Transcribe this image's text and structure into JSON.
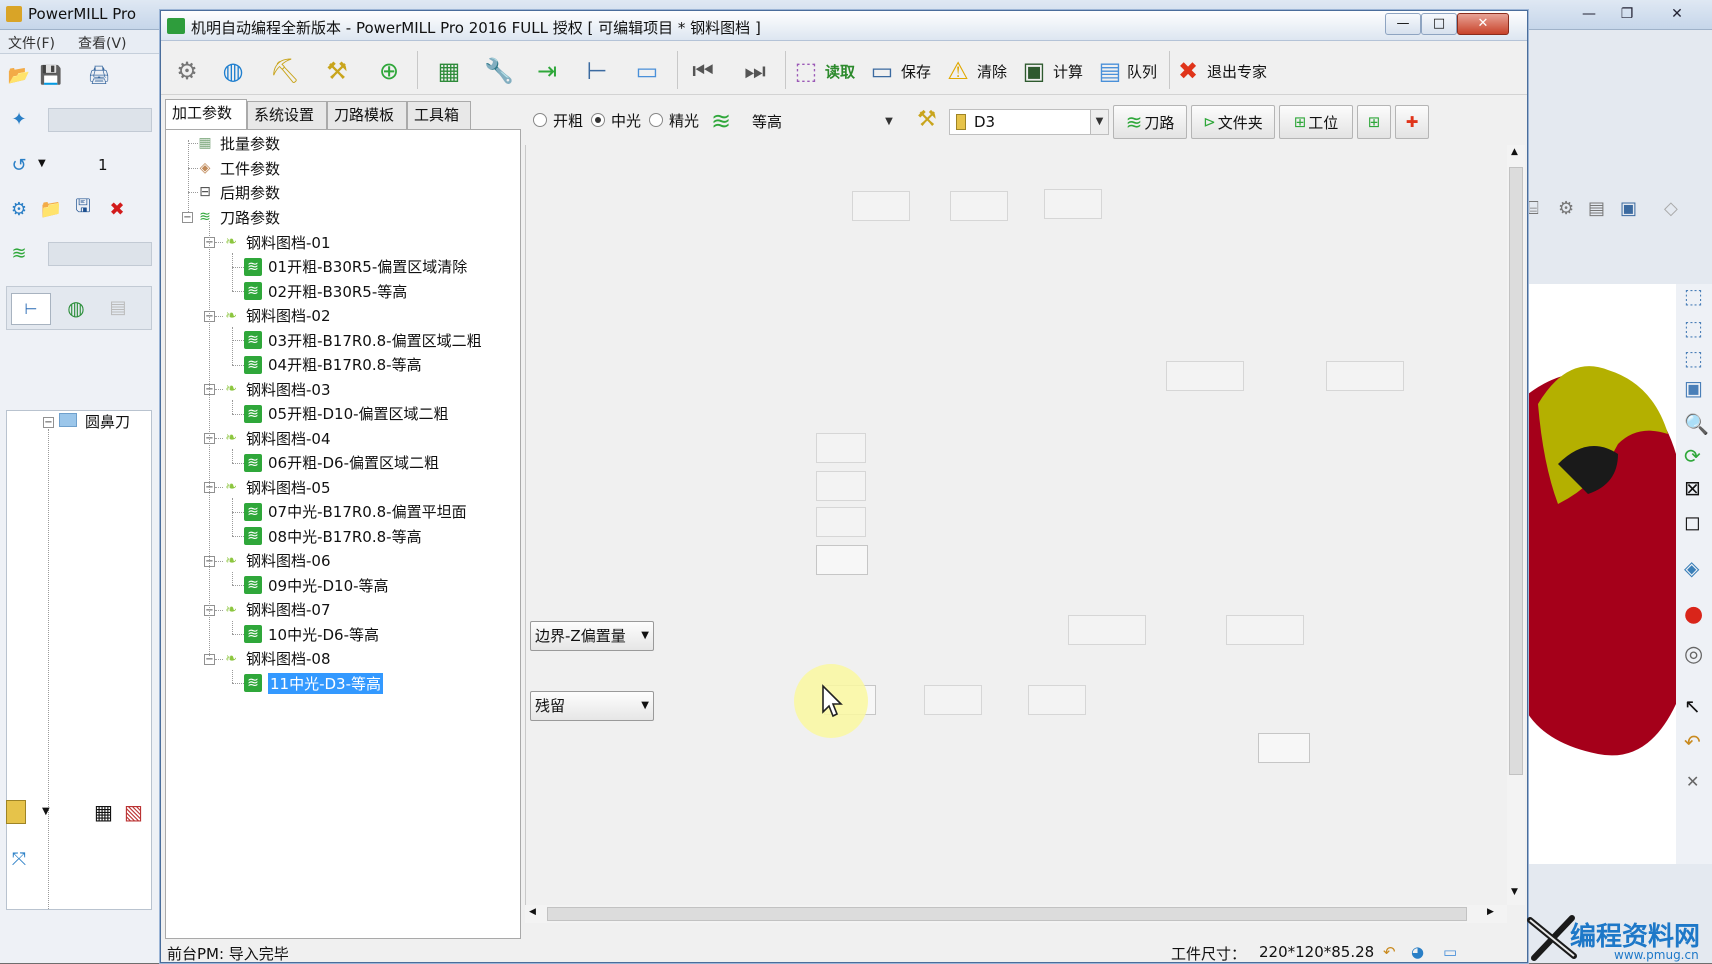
{
  "background_app": {
    "title": "PowerMILL Pro",
    "menu": [
      "文件(F)",
      "查看(V)"
    ],
    "toolbar_value": "1",
    "tree_root": "圆鼻刀"
  },
  "dialog": {
    "title": "机明自动编程全新版本 - PowerMILL Pro 2016 FULL 授权    [ 可编辑项目 * 钢料图档 ]",
    "toolbar": {
      "read_label": "读取",
      "save_label": "保存",
      "clear_label": "清除",
      "calc_label": "计算",
      "queue_label": "队列",
      "exit_label": "退出专家"
    },
    "tabs": [
      "加工参数",
      "系统设置",
      "刀路模板",
      "工具箱"
    ],
    "tree": {
      "top_items": [
        "批量参数",
        "工件参数",
        "后期参数",
        "刀路参数"
      ],
      "groups": [
        {
          "label": "钢料图档-01",
          "items": [
            "01开粗-B30R5-偏置区域清除",
            "02开粗-B30R5-等高"
          ]
        },
        {
          "label": "钢料图档-02",
          "items": [
            "03开粗-B17R0.8-偏置区域二粗",
            "04开粗-B17R0.8-等高"
          ]
        },
        {
          "label": "钢料图档-03",
          "items": [
            "05开粗-D10-偏置区域二粗"
          ]
        },
        {
          "label": "钢料图档-04",
          "items": [
            "06开粗-D6-偏置区域二粗"
          ]
        },
        {
          "label": "钢料图档-05",
          "items": [
            "07中光-B17R0.8-偏置平坦面",
            "08中光-B17R0.8-等高"
          ]
        },
        {
          "label": "钢料图档-06",
          "items": [
            "09中光-D10-等高"
          ]
        },
        {
          "label": "钢料图档-07",
          "items": [
            "10中光-D6-等高"
          ]
        },
        {
          "label": "钢料图档-08",
          "items": [
            "11中光-D3-等高"
          ]
        }
      ],
      "selected": "11中光-D3-等高"
    },
    "options": {
      "radio_labels": [
        "开粗",
        "中光",
        "精光"
      ],
      "selected_radio": "中光",
      "strategy_value": "等高",
      "tool_value": "D3",
      "toolpath_btn": "刀路",
      "folder_btn": "文件夹",
      "workplane_btn": "工位"
    },
    "canvas": {
      "boundary_dropdown": "边界-Z偏置量",
      "residual_dropdown": "残留"
    },
    "status": {
      "left": "前台PM: 导入完毕",
      "size_label": "工件尺寸：",
      "size_value": "220*120*85.28"
    }
  },
  "watermark": {
    "text": "编程资料网",
    "url": "www.pmug.cn"
  },
  "colors": {
    "selection": "#3399ff",
    "model_red": "#a5001a",
    "model_yellow": "#b4b000"
  }
}
